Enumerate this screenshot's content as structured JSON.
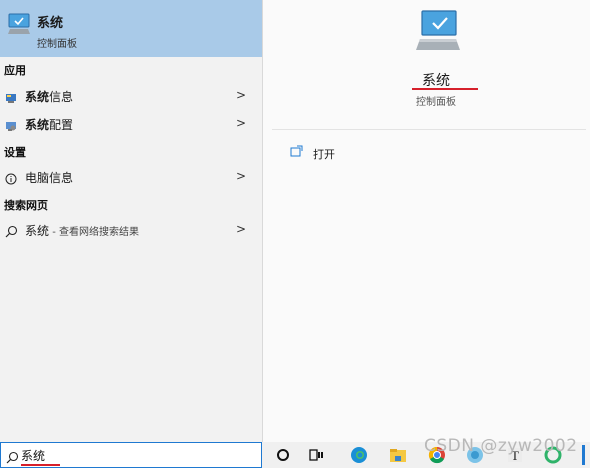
{
  "best_match": {
    "title": "系统",
    "subtitle": "控制面板",
    "icon": "system-monitor-icon"
  },
  "sections": {
    "apps": "应用",
    "settings": "设置",
    "web": "搜索网页"
  },
  "apps": [
    {
      "bold": "系统",
      "rest": "信息",
      "icon": "system-info-icon"
    },
    {
      "bold": "系统",
      "rest": "配置",
      "icon": "system-config-icon"
    }
  ],
  "settings_items": [
    {
      "label": "电脑信息",
      "icon": "info-icon"
    }
  ],
  "web_items": [
    {
      "label": "系统",
      "suffix": " - 查看网络搜索结果",
      "icon": "search-icon"
    }
  ],
  "detail": {
    "title": "系统",
    "subtitle": "控制面板",
    "actions": [
      {
        "label": "打开",
        "icon": "open-icon"
      }
    ]
  },
  "search": {
    "value": "系统"
  },
  "taskbar": {
    "icons": [
      "cortana-icon",
      "task-view-icon",
      "edge-icon",
      "file-explorer-icon",
      "chrome-icon",
      "app-icon",
      "typora-icon",
      "refresh-icon"
    ]
  },
  "watermark": "CSDN @zyw2002",
  "colors": {
    "highlight": "#a9cae8",
    "accent": "#1f79d1",
    "annotation": "#d6202b"
  }
}
